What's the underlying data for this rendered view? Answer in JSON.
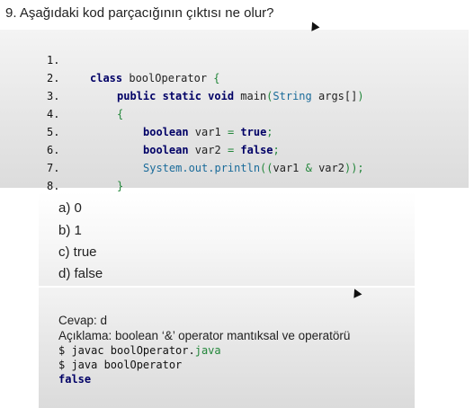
{
  "question": "9. Aşağıdaki kod parçacığının çıktısı ne olur?",
  "code": {
    "line_numbers": [
      "1.",
      "2.",
      "3.",
      "4.",
      "5.",
      "6.",
      "7.",
      "8."
    ],
    "l1": {
      "kw": "class",
      "name": " boolOperator ",
      "brace": "{"
    },
    "l2": {
      "kw": "public static void",
      "name": " main",
      "p1": "(",
      "type": "String",
      "args": " args[]",
      "p2": ")"
    },
    "l3": {
      "brace": "{"
    },
    "l4": {
      "kw": "boolean",
      "decl": " var1 ",
      "eq": "=",
      "val": " true",
      "semi": ";"
    },
    "l5": {
      "kw": "boolean",
      "decl": " var2 ",
      "eq": "=",
      "val": " false",
      "semi": ";"
    },
    "l6": {
      "call": "System.out.println",
      "open": "((",
      "a": "var1 ",
      "amp": "&",
      "b": " var2",
      "close": "));"
    },
    "l7": {
      "brace": "}"
    },
    "l8": {
      "brace": "}"
    }
  },
  "options": [
    "a) 0",
    "b) 1",
    "c) true",
    "d) false"
  ],
  "answer": {
    "cevap": "Cevap: d",
    "aciklama": "Açıklama: boolean ‘&’ operator mantıksal ve operatörü",
    "cmd1_prefix": "$ javac boolOperator.",
    "cmd1_ext": "java",
    "cmd2": "$ java boolOperator",
    "output": "false"
  }
}
